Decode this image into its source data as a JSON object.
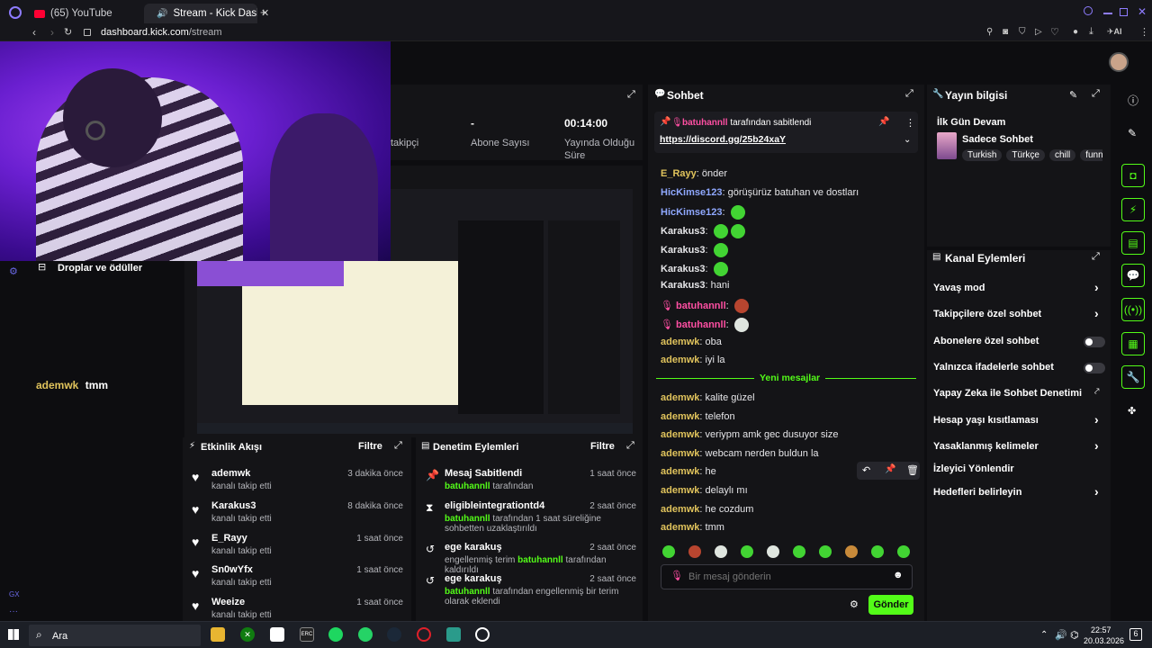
{
  "browser": {
    "tabs": [
      {
        "label": "(65) YouTube"
      },
      {
        "label": "Stream - Kick Dashbo"
      }
    ],
    "address_domain": "dashboard.kick.com",
    "address_path": "/stream",
    "ai_label": "AI"
  },
  "stats": [
    {
      "label": "takipçi"
    },
    {
      "value": "-",
      "label": "Abone Sayısı"
    },
    {
      "value": "00:14:00",
      "label": "Yayında Olduğu Süre"
    }
  ],
  "drops": {
    "title": "Droplar ve ödüller"
  },
  "chat_overlay": {
    "user": "ademwk",
    "text": "tmm"
  },
  "chat": {
    "title": "Sohbet",
    "pinned": {
      "user": "batuhannll",
      "by_text": "tarafından sabitlendi",
      "link": "https://discord.gg/25b24xaY"
    },
    "messages": [
      {
        "user": "E_Rayy",
        "text": "önder",
        "color": "#e0c35c",
        "emotes": 0
      },
      {
        "user": "HicKimse123",
        "text": "görüşürüz batuhan ve dostları",
        "color": "#8fa8ff",
        "emotes": 0
      },
      {
        "user": "HicKimse123",
        "text": "",
        "color": "#8fa8ff",
        "emotes": 1
      },
      {
        "user": "Karakus3",
        "text": "",
        "color": "#e6e6e9",
        "emotes": 2
      },
      {
        "user": "Karakus3",
        "text": "",
        "color": "#e6e6e9",
        "emotes": 1
      },
      {
        "user": "Karakus3",
        "text": "",
        "color": "#e6e6e9",
        "emotes": 1
      },
      {
        "user": "Karakus3",
        "text": "hani",
        "color": "#e6e6e9",
        "emotes": 0
      },
      {
        "user": "batuhannll",
        "text": "",
        "color": "#ff4fa3",
        "emotes": 1
      },
      {
        "user": "batuhannll",
        "text": "",
        "color": "#ff4fa3",
        "emotes": 1
      },
      {
        "user": "ademwk",
        "text": "oba",
        "color": "#e0c35c",
        "emotes": 0
      },
      {
        "user": "ademwk",
        "text": "iyi la",
        "color": "#e0c35c",
        "emotes": 0
      }
    ],
    "new_divider": "Yeni mesajlar",
    "new_messages": [
      {
        "user": "ademwk",
        "text": "kalite güzel"
      },
      {
        "user": "ademwk",
        "text": "telefon"
      },
      {
        "user": "ademwk",
        "text": "veriypm amk gec dusuyor size"
      },
      {
        "user": "ademwk",
        "text": "webcam nerden buldun la"
      },
      {
        "user": "ademwk",
        "text": "he"
      },
      {
        "user": "ademwk",
        "text": "delaylı mı"
      },
      {
        "user": "ademwk",
        "text": "he cozdum"
      },
      {
        "user": "ademwk",
        "text": "tmm"
      }
    ],
    "input_placeholder": "Bir mesaj gönderin",
    "send_label": "Gönder"
  },
  "stream_info": {
    "title": "Yayın bilgisi",
    "stream_title": "İlk Gün Devam",
    "category": "Sadece Sohbet",
    "tags": [
      "Turkish",
      "Türkçe",
      "chill",
      "funn"
    ]
  },
  "channel_actions": {
    "title": "Kanal Eylemleri",
    "items": [
      {
        "label": "Yavaş mod",
        "control": "chevron"
      },
      {
        "label": "Takipçilere özel sohbet",
        "control": "chevron"
      },
      {
        "label": "Abonelere özel sohbet",
        "control": "toggle"
      },
      {
        "label": "Yalnızca ifadelerle sohbet",
        "control": "toggle"
      },
      {
        "label": "Yapay Zeka ile Sohbet Denetimi",
        "control": "external"
      },
      {
        "label": "Hesap yaşı kısıtlaması",
        "control": "chevron"
      },
      {
        "label": "Yasaklanmış kelimeler",
        "control": "chevron"
      },
      {
        "label": "İzleyici Yönlendir",
        "control": "none"
      },
      {
        "label": "Hedefleri belirleyin",
        "control": "chevron"
      }
    ]
  },
  "activity": {
    "title": "Etkinlik Akışı",
    "filter": "Filtre",
    "items": [
      {
        "name": "ademwk",
        "sub": "kanalı takip etti",
        "time": "3 dakika önce"
      },
      {
        "name": "Karakus3",
        "sub": "kanalı takip etti",
        "time": "8 dakika önce"
      },
      {
        "name": "E_Rayy",
        "sub": "kanalı takip etti",
        "time": "1 saat önce"
      },
      {
        "name": "Sn0wYfx",
        "sub": "kanalı takip etti",
        "time": "1 saat önce"
      },
      {
        "name": "Weeize",
        "sub": "kanalı takip etti",
        "time": "1 saat önce"
      }
    ]
  },
  "moderation": {
    "title": "Denetim Eylemleri",
    "filter": "Filtre",
    "items": [
      {
        "name": "Mesaj Sabitlendi",
        "actor": "batuhannll",
        "rest": "tarafından",
        "time": "1 saat önce"
      },
      {
        "name": "eligibleintegrationtd4",
        "actor": "batuhannll",
        "rest": "tarafından 1 saat süreliğine sohbetten uzaklaştırıldı",
        "time": "2 saat önce"
      },
      {
        "name": "ege karakuş",
        "actor": "",
        "rest": "engellenmiş terim",
        "actor2": "batuhannll",
        "rest2": "tarafından kaldırıldı",
        "time": "2 saat önce"
      },
      {
        "name": "ege karakuş",
        "actor": "batuhannll",
        "rest": "tarafından engellenmiş bir terim olarak eklendi",
        "time": "2 saat önce"
      }
    ]
  },
  "taskbar": {
    "search": "Ara",
    "time": "22:57",
    "date": "20.03.2026",
    "notif_count": "6"
  },
  "colors": {
    "accent": "#53fc18",
    "panel": "#141417",
    "mod_pink": "#ff4fa3",
    "user_gold": "#e0c35c"
  }
}
